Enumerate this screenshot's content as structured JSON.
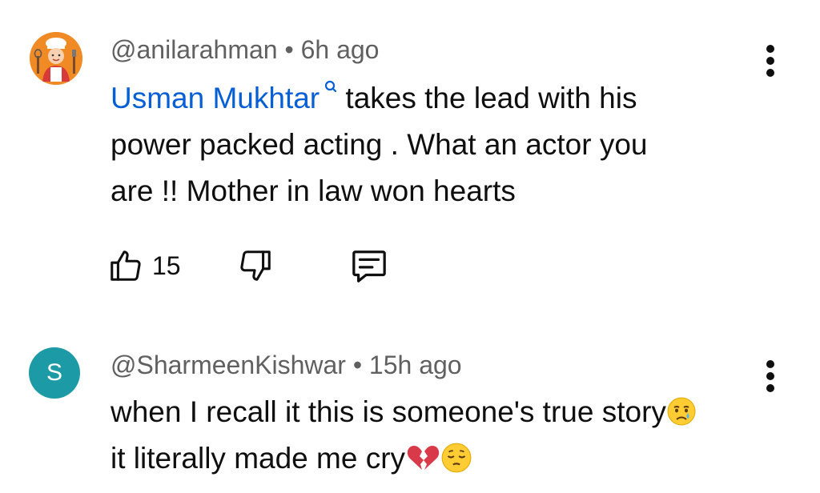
{
  "comments": [
    {
      "handle": "@anilarahman",
      "separator": "•",
      "time": "6h ago",
      "mention": "Usman Mukhtar",
      "lines": [
        "takes the lead with his",
        "power packed acting . What an actor you",
        "are !! Mother in law won hearts"
      ],
      "likes": "15",
      "avatar_icon": "chef-avatar-icon"
    },
    {
      "handle": "@SharmeenKishwar",
      "separator": "•",
      "time": "15h ago",
      "avatar_letter": "S",
      "lines": [
        "when I recall it this is someone's true story",
        "it literally made me cry"
      ],
      "emojis": [
        "crying-face-icon",
        "broken-heart-icon",
        "pensive-face-icon"
      ]
    }
  ],
  "colors": {
    "mention": "#065fd4",
    "meta": "#606060",
    "avatar_teal": "#1c9aa6",
    "avatar_orange": "#f08a24"
  }
}
